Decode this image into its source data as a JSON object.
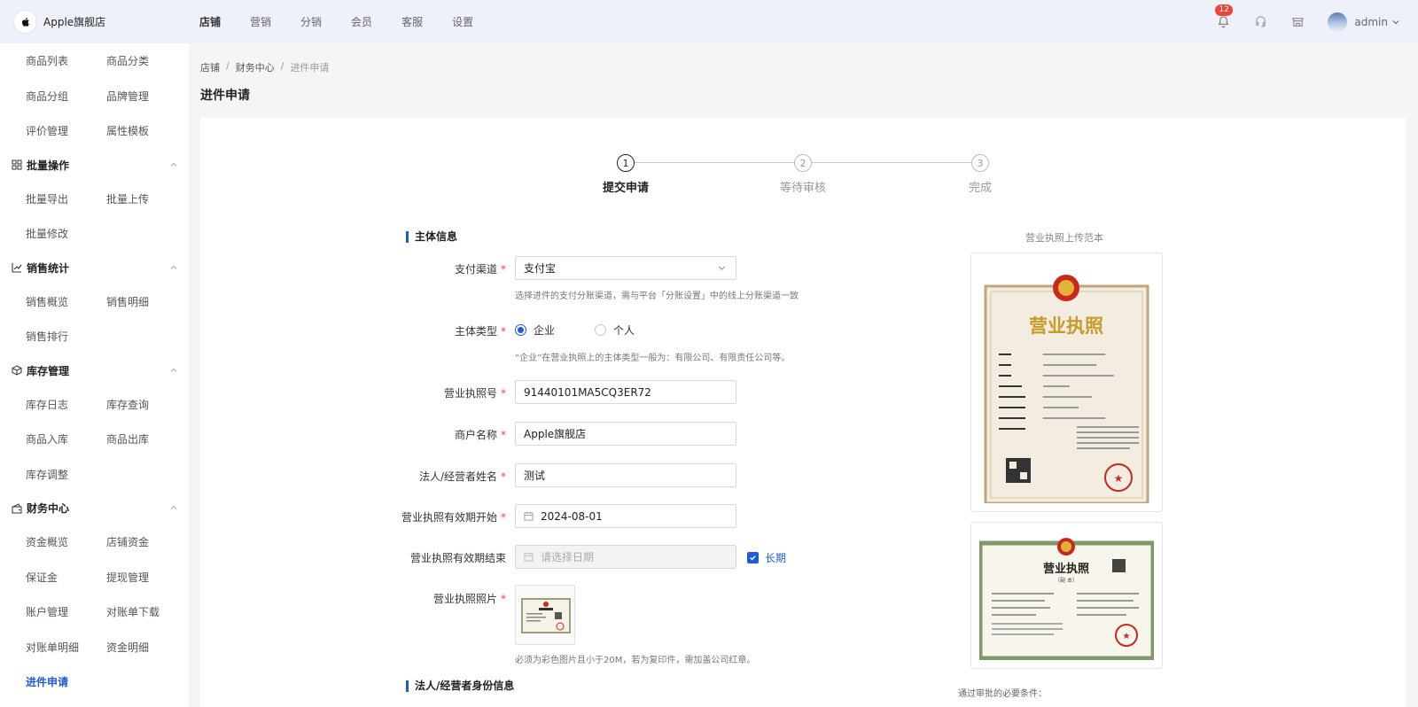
{
  "brand": {
    "name": "Apple旗舰店",
    "logo_text": ""
  },
  "topnav": [
    {
      "label": "店铺",
      "active": true
    },
    {
      "label": "营销",
      "active": false
    },
    {
      "label": "分销",
      "active": false
    },
    {
      "label": "会员",
      "active": false
    },
    {
      "label": "客服",
      "active": false
    },
    {
      "label": "设置",
      "active": false
    }
  ],
  "header": {
    "notification_count": "12",
    "username": "admin"
  },
  "sidebar": {
    "rows1": [
      [
        "商品列表",
        "商品分类"
      ],
      [
        "商品分组",
        "品牌管理"
      ],
      [
        "评价管理",
        "属性模板"
      ]
    ],
    "groups": [
      {
        "title": "批量操作",
        "rows": [
          [
            "批量导出",
            "批量上传"
          ],
          [
            "批量修改",
            ""
          ]
        ]
      },
      {
        "title": "销售统计",
        "rows": [
          [
            "销售概览",
            "销售明细"
          ],
          [
            "销售排行",
            ""
          ]
        ]
      },
      {
        "title": "库存管理",
        "rows": [
          [
            "库存日志",
            "库存查询"
          ],
          [
            "商品入库",
            "商品出库"
          ],
          [
            "库存调整",
            ""
          ]
        ]
      },
      {
        "title": "财务中心",
        "rows": [
          [
            "资金概览",
            "店铺资金"
          ],
          [
            "保证金",
            "提现管理"
          ],
          [
            "账户管理",
            "对账单下载"
          ],
          [
            "对账单明细",
            "资金明细"
          ],
          [
            "进件申请",
            ""
          ]
        ]
      }
    ],
    "active_item": "进件申请"
  },
  "breadcrumb": [
    "店铺",
    "财务中心",
    "进件申请"
  ],
  "page_title": "进件申请",
  "steps": [
    {
      "num": "1",
      "label": "提交申请",
      "active": true
    },
    {
      "num": "2",
      "label": "等待审核",
      "active": false
    },
    {
      "num": "3",
      "label": "完成",
      "active": false
    }
  ],
  "form": {
    "section1": "主体信息",
    "pay_channel": {
      "label": "支付渠道",
      "value": "支付宝",
      "hint": "选择进件的支付分账渠道，需与平台「分账设置」中的线上分账渠道一致"
    },
    "entity_type": {
      "label": "主体类型",
      "options": [
        "企业",
        "个人"
      ],
      "selected": "企业",
      "hint": "“企业”在营业执照上的主体类型一般为：有限公司、有限责任公司等。"
    },
    "license_no": {
      "label": "营业执照号",
      "value": "91440101MA5CQ3ER72"
    },
    "merchant_name": {
      "label": "商户名称",
      "value": "Apple旗舰店"
    },
    "legal_name": {
      "label": "法人/经营者姓名",
      "value": "测试"
    },
    "valid_start": {
      "label": "营业执照有效期开始",
      "value": "2024-08-01"
    },
    "valid_end": {
      "label": "营业执照有效期结束",
      "placeholder": "请选择日期",
      "long_term": "长期"
    },
    "license_photo": {
      "label": "营业执照照片",
      "hint": "必须为彩色图片且小于20M，若为复印件，需加盖公司红章。"
    },
    "section2": "法人/经营者身份信息"
  },
  "sample": {
    "title": "营业执照上传范本",
    "license1_title": "营业执照",
    "license2_title": "营业执照",
    "license2_sub": "（副 本）"
  },
  "bottom_note": "通过审批的必要条件：",
  "colors": {
    "accent": "#1f5bd8",
    "required": "#f04438",
    "seal": "#c8281e",
    "gold": "#c89a2a"
  }
}
